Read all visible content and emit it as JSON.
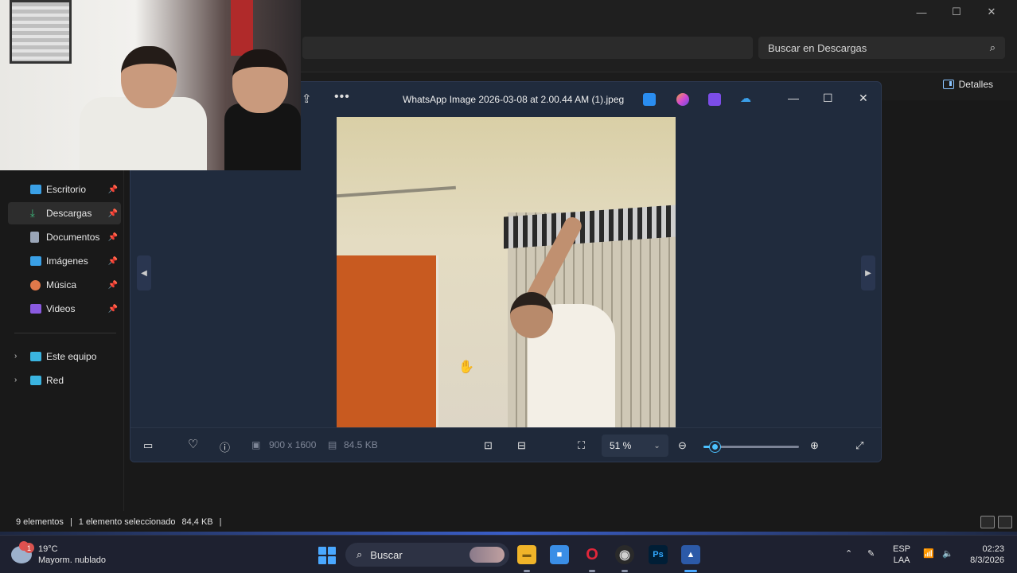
{
  "explorer": {
    "search_placeholder": "Buscar en Descargas",
    "details_label": "Detalles",
    "window_controls": [
      "minimize-icon",
      "maximize-icon",
      "close-icon"
    ],
    "sidebar": {
      "items": [
        {
          "label": "Escritorio",
          "icon": "desktop-icon",
          "color": "#3aa0e6",
          "pinned": true
        },
        {
          "label": "Descargas",
          "icon": "download-icon",
          "color": "#3fbf7f",
          "pinned": true,
          "active": true
        },
        {
          "label": "Documentos",
          "icon": "document-icon",
          "color": "#9aa6b8",
          "pinned": true
        },
        {
          "label": "Imágenes",
          "icon": "image-icon",
          "color": "#3aa0e6",
          "pinned": true
        },
        {
          "label": "Música",
          "icon": "music-icon",
          "color": "#e0784a",
          "pinned": true
        },
        {
          "label": "Videos",
          "icon": "video-icon",
          "color": "#8a5ae0",
          "pinned": true
        }
      ],
      "tree": [
        {
          "label": "Este equipo",
          "icon": "computer-icon"
        },
        {
          "label": "Red",
          "icon": "network-icon"
        }
      ]
    },
    "status": {
      "count": "9 elementos",
      "selection": "1 elemento seleccionado",
      "size": "84,4 KB"
    }
  },
  "viewer": {
    "filename": "WhatsApp Image 2026-03-08 at 2.00.44 AM (1).jpeg",
    "dimensions": "900 x 1600",
    "filesize": "84.5 KB",
    "zoom": "51 %",
    "zoom_fraction": 0.12,
    "app_icons": [
      {
        "name": "photos-edit-icon",
        "color": "#2a8df0"
      },
      {
        "name": "designer-icon",
        "color": "#d44ad0"
      },
      {
        "name": "clipchamp-icon",
        "color": "#7c4de8"
      },
      {
        "name": "onedrive-off-icon",
        "color": "#3a9ee8"
      }
    ]
  },
  "taskbar": {
    "weather": {
      "temp": "19°C",
      "desc": "Mayorm. nublado",
      "badge": "1"
    },
    "search": "Buscar",
    "apps": [
      {
        "name": "file-explorer-icon",
        "color": "#f0b429",
        "glyph": "▬"
      },
      {
        "name": "store-icon",
        "color": "#3a8ee6",
        "glyph": "■"
      },
      {
        "name": "opera-icon",
        "color": "#e0263a",
        "glyph": "O"
      },
      {
        "name": "obs-icon",
        "color": "#d0d0d0",
        "glyph": "◉"
      },
      {
        "name": "photoshop-icon",
        "color": "#31a8ff",
        "glyph": "Ps"
      },
      {
        "name": "photos-icon",
        "color": "#4aa8ff",
        "glyph": "▲"
      }
    ],
    "lang": {
      "top": "ESP",
      "bottom": "LAA"
    },
    "clock": {
      "time": "02:23",
      "date": "8/3/2026"
    }
  }
}
